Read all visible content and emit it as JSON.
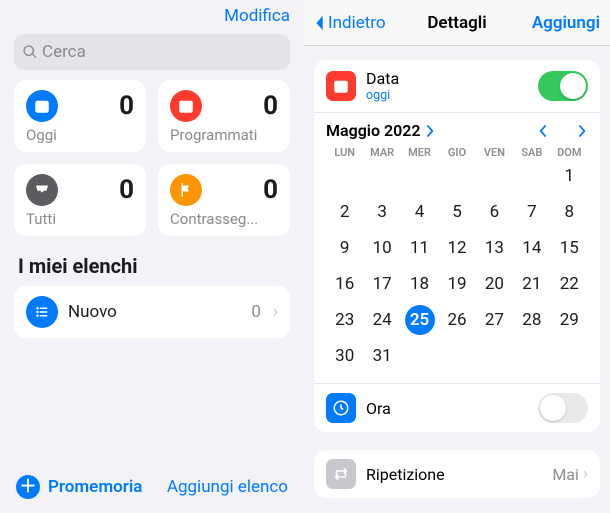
{
  "left": {
    "edit": "Modifica",
    "search_placeholder": "Cerca",
    "cards": [
      {
        "label": "Oggi",
        "count": 0,
        "color": "#007aff",
        "icon": "calendar-25"
      },
      {
        "label": "Programmati",
        "count": 0,
        "color": "#ff3b30",
        "icon": "calendar"
      },
      {
        "label": "Tutti",
        "count": 0,
        "color": "#5b5b60",
        "icon": "tray"
      },
      {
        "label": "Contrasseg...",
        "count": 0,
        "color": "#ff9500",
        "icon": "flag"
      }
    ],
    "section": "I miei elenchi",
    "list": {
      "name": "Nuovo",
      "count": 0,
      "color": "#007aff"
    },
    "new_reminder": "Promemoria",
    "add_list": "Aggiungi elenco"
  },
  "right": {
    "back": "Indietro",
    "title": "Dettagli",
    "action": "Aggiungi",
    "date": {
      "title": "Data",
      "subtitle": "oggi",
      "color": "#ff3b30",
      "on": true
    },
    "calendar": {
      "month_label": "Maggio 2022",
      "dow": [
        "LUN",
        "MAR",
        "MER",
        "GIO",
        "VEN",
        "SAB",
        "DOM"
      ],
      "leading_blanks": 6,
      "days": 31,
      "selected": 25
    },
    "time": {
      "title": "Ora",
      "color": "#007aff",
      "on": false
    },
    "repeat": {
      "title": "Ripetizione",
      "value": "Mai"
    }
  }
}
